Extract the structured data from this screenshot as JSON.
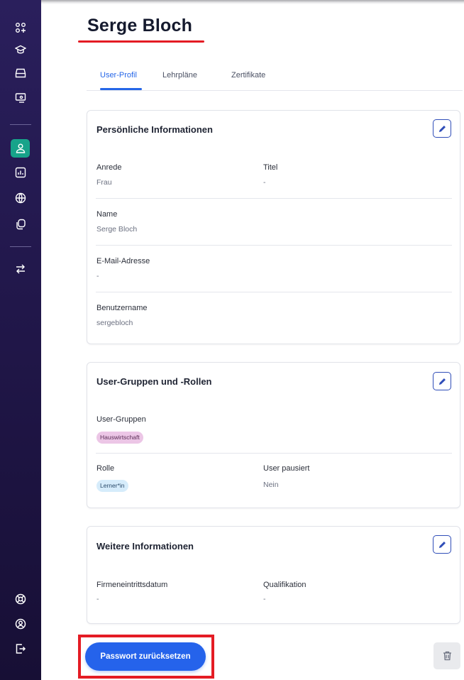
{
  "sidebar": {
    "top_icons": [
      "apps-icon",
      "graduation-cap-icon",
      "inbox-icon",
      "presentation-icon"
    ],
    "middle_icons": [
      "users-icon",
      "report-chart-icon",
      "globe-icon",
      "copy-icon"
    ],
    "switch_icon": "switch-arrows-icon",
    "bottom_icons": [
      "help-lifebuoy-icon",
      "user-circle-icon",
      "logout-icon"
    ],
    "active_color": "#17a38a"
  },
  "page": {
    "title": "Serge Bloch",
    "highlight_color": "#e41c24"
  },
  "tabs": [
    {
      "label": "User-Profil",
      "active": true
    },
    {
      "label": "Lehrpläne",
      "active": false
    },
    {
      "label": "Zertifikate",
      "active": false
    }
  ],
  "personal": {
    "title": "Persönliche Informationen",
    "salutation_label": "Anrede",
    "salutation_value": "Frau",
    "title_label": "Titel",
    "title_value": "-",
    "name_label": "Name",
    "name_value": "Serge Bloch",
    "email_label": "E-Mail-Adresse",
    "email_value": "-",
    "username_label": "Benutzername",
    "username_value": "sergebloch"
  },
  "groups": {
    "title": "User-Gruppen und -Rollen",
    "groups_label": "User-Gruppen",
    "group_badge": "Hauswirtschaft",
    "role_label": "Rolle",
    "role_badge": "Lerner*in",
    "paused_label": "User pausiert",
    "paused_value": "Nein"
  },
  "more": {
    "title": "Weitere Informationen",
    "entry_date_label": "Firmeneintrittsdatum",
    "entry_date_value": "-",
    "qualification_label": "Qualifikation",
    "qualification_value": "-"
  },
  "actions": {
    "reset_password": "Passwort zurücksetzen",
    "primary_color": "#2563eb"
  }
}
